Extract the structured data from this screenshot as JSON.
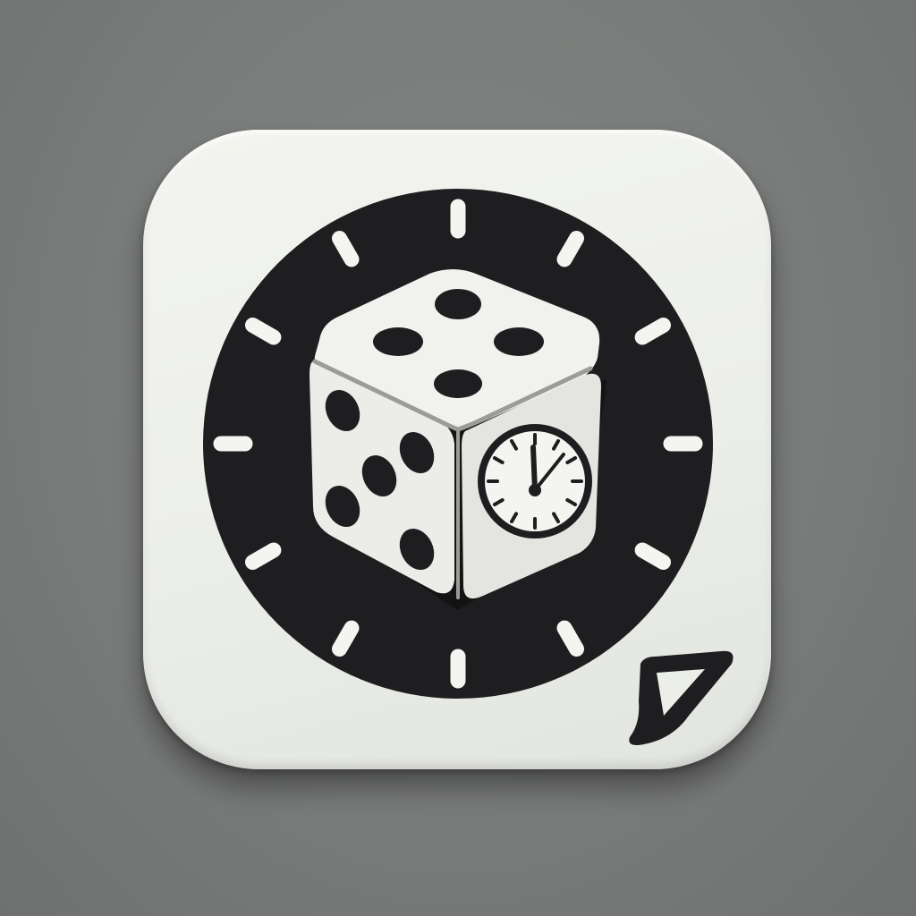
{
  "icon": {
    "name": "dice-timer-app-icon",
    "tile_color": "#eef0eb",
    "dial_color": "#1e1e20",
    "die_color": "#f1f2ee",
    "background_color": "#7b7d7c",
    "dial_markers": 12,
    "die_top_face_pips": 4,
    "die_left_face_pips": 6,
    "clock_face_ticks": 12,
    "corner_badge_icon": "play-triangle-icon"
  }
}
